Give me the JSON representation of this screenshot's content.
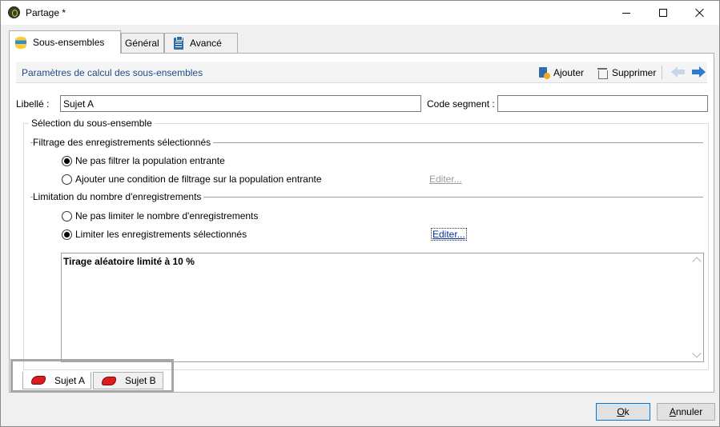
{
  "window": {
    "title": "Partage *"
  },
  "tabs": [
    {
      "label": "Sous-ensembles",
      "icon": "database-icon"
    },
    {
      "label": "Général"
    },
    {
      "label": "Avancé",
      "icon": "clipboard-icon"
    }
  ],
  "header": {
    "title": "Paramètres de calcul des sous-ensembles",
    "add_label": "Ajouter",
    "delete_label": "Supprimer"
  },
  "form": {
    "libelle_label": "Libellé :",
    "libelle_value": "Sujet A",
    "code_segment_label": "Code segment :",
    "code_segment_value": ""
  },
  "selection": {
    "title": "Sélection du sous-ensemble",
    "filtering": {
      "title": "Filtrage des enregistrements sélectionnés",
      "option_no_filter": "Ne pas filtrer la population entrante",
      "option_add_condition": "Ajouter une condition de filtrage sur la population entrante",
      "edit_label": "Editer...",
      "selected": "no_filter"
    },
    "limitation": {
      "title": "Limitation du nombre d'enregistrements",
      "option_no_limit": "Ne pas limiter le nombre d'enregistrements",
      "option_limit": "Limiter les enregistrements sélectionnés",
      "edit_label": "Editer...",
      "selected": "limit"
    },
    "description": "Tirage aléatoire limité à 10 %"
  },
  "subset_tabs": [
    {
      "label": "Sujet A"
    },
    {
      "label": "Sujet B"
    }
  ],
  "buttons": {
    "ok": "Ok",
    "cancel": "Annuler"
  },
  "colors": {
    "header_title": "#1e4e8a",
    "link": "#0033aa",
    "accent_arrow": "#2e7ad1",
    "subset_icon": "#d81e1e"
  }
}
